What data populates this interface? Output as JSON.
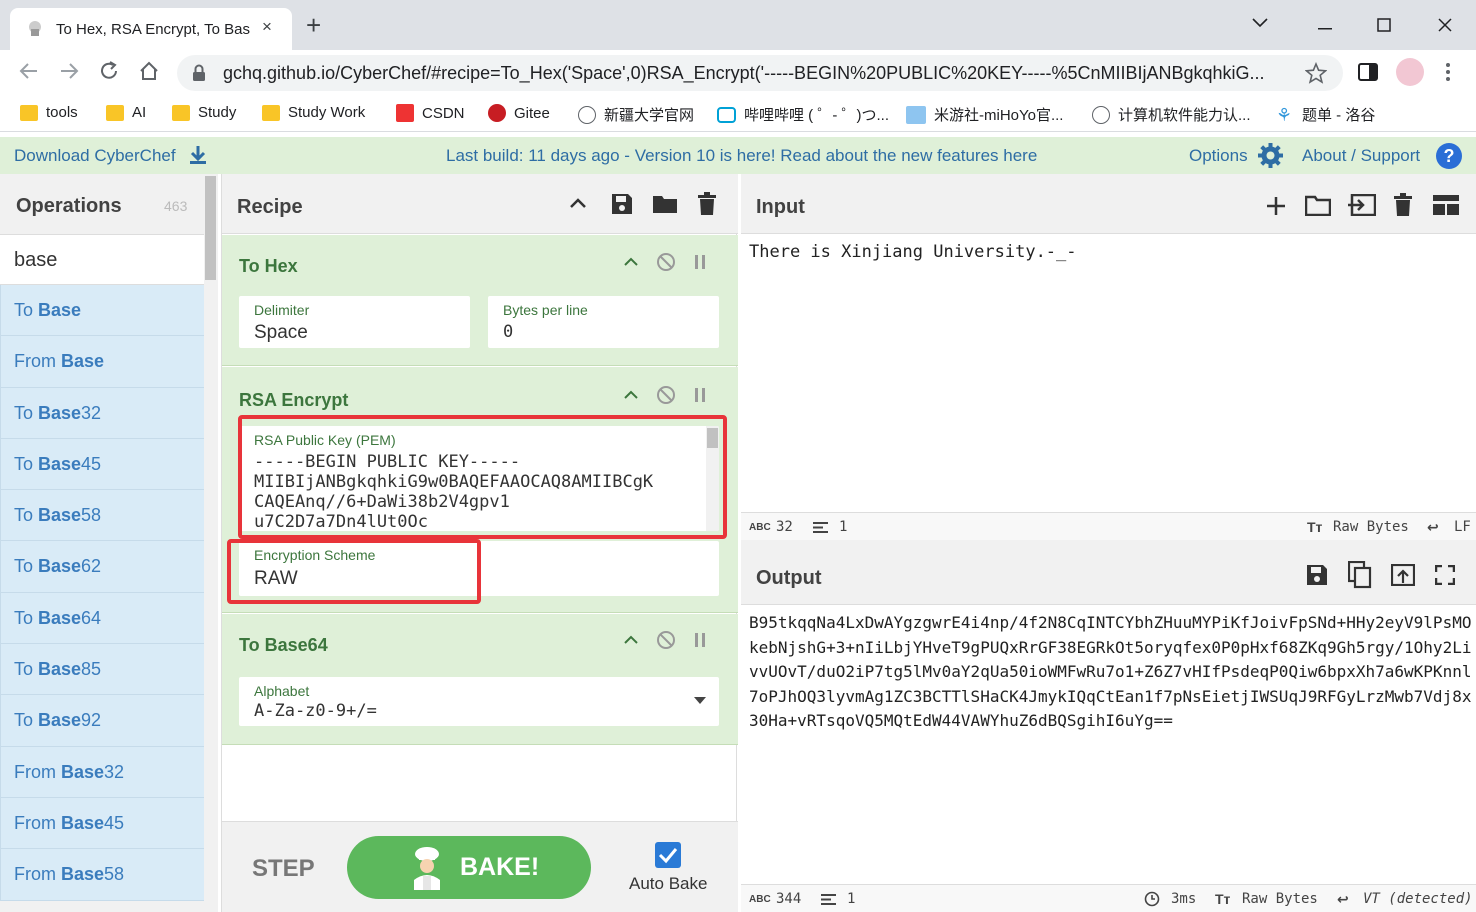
{
  "browser": {
    "tab_title": "To Hex, RSA Encrypt, To Bas",
    "tab_close": "×",
    "new_tab": "+",
    "url": "gchq.github.io/CyberChef/#recipe=To_Hex('Space',0)RSA_Encrypt('-----BEGIN%20PUBLIC%20KEY-----%5CnMIIBIjANBgkqhkiG...",
    "bookmarks": [
      "tools",
      "AI",
      "Study",
      "Study Work",
      "CSDN",
      "Gitee",
      "新疆大学官网",
      "哔哩哔哩 ( ゜- ゜)つ...",
      "米游社-miHoYo官...",
      "计算机软件能力认...",
      "题单 - 洛谷"
    ]
  },
  "banner": {
    "download": "Download CyberChef",
    "notice": "Last build: 11 days ago - Version 10 is here! Read about the new features here",
    "options": "Options",
    "about": "About / Support"
  },
  "operations": {
    "title": "Operations",
    "count": "463",
    "search_value": "base",
    "items": [
      {
        "pre": "To ",
        "hl": "Base",
        "post": ""
      },
      {
        "pre": "From ",
        "hl": "Base",
        "post": ""
      },
      {
        "pre": "To ",
        "hl": "Base",
        "post": "32"
      },
      {
        "pre": "To ",
        "hl": "Base",
        "post": "45"
      },
      {
        "pre": "To ",
        "hl": "Base",
        "post": "58"
      },
      {
        "pre": "To ",
        "hl": "Base",
        "post": "62"
      },
      {
        "pre": "To ",
        "hl": "Base",
        "post": "64"
      },
      {
        "pre": "To ",
        "hl": "Base",
        "post": "85"
      },
      {
        "pre": "To ",
        "hl": "Base",
        "post": "92"
      },
      {
        "pre": "From ",
        "hl": "Base",
        "post": "32"
      },
      {
        "pre": "From ",
        "hl": "Base",
        "post": "45"
      },
      {
        "pre": "From ",
        "hl": "Base",
        "post": "58"
      }
    ]
  },
  "recipe": {
    "title": "Recipe",
    "to_hex": {
      "name": "To Hex",
      "delimiter_label": "Delimiter",
      "delimiter_value": "Space",
      "bpl_label": "Bytes per line",
      "bpl_value": "0"
    },
    "rsa": {
      "name": "RSA Encrypt",
      "key_label": "RSA Public Key (PEM)",
      "key_lines": [
        "-----BEGIN PUBLIC KEY-----",
        "MIIBIjANBgkqhkiG9w0BAQEFAAOCAQ8AMIIBCgK",
        "CAQEAnq//6+DaWi38b2V4gpv1",
        "u7C2D7a7Dn4lUt0Oc"
      ],
      "scheme_label": "Encryption Scheme",
      "scheme_value": "RAW"
    },
    "to_base64": {
      "name": "To Base64",
      "alphabet_label": "Alphabet",
      "alphabet_value": "A-Za-z0-9+/="
    },
    "step": "STEP",
    "bake": "BAKE!",
    "auto_bake": "Auto Bake"
  },
  "input": {
    "title": "Input",
    "text": "There is Xinjiang University.-_-",
    "status": {
      "abc": "ABC",
      "chars": "32",
      "lines": "1",
      "encoding": "Raw Bytes",
      "eol": "LF"
    }
  },
  "output": {
    "title": "Output",
    "text": "B95tkqqNa4LxDwAYgzgwrE4i4np/4f2N8CqINTCYbhZHuuMYPiKfJoivFpSNd+HHy2eyV9lPsMOkebNjshG+3+nIiLbjYHveT9gPUQxRrGF38EGRkOt5oryqfex0P0pHxf68ZKq9Gh5rgy/1Ohy2LivvUOvT/duO2iP7tg5lMv0aY2qUa50ioWMFwRu7o1+Z6Z7vHIfPsdeqP0Qiw6bpxXh7a6wKPKnnl7oPJhOQ3lyvmAg1ZC3BCTTlSHaCK4JmykIQqCtEan1f7pNsEietjIWSUqJ9RFGyLrzMwb7Vdj8x30Ha+vRTsqoVQ5MQtEdW44VAWYhuZ6dBQSgihI6uYg==",
    "status": {
      "abc": "ABC",
      "chars": "344",
      "lines": "1",
      "time": "3ms",
      "encoding": "Raw Bytes",
      "eol": "VT (detected)"
    }
  },
  "colors": {
    "accent": "#e8343a",
    "banner": "#dff0d8",
    "ingredient": "#dff0d8",
    "bake": "#5cb85c",
    "link": "#2e6da4"
  }
}
